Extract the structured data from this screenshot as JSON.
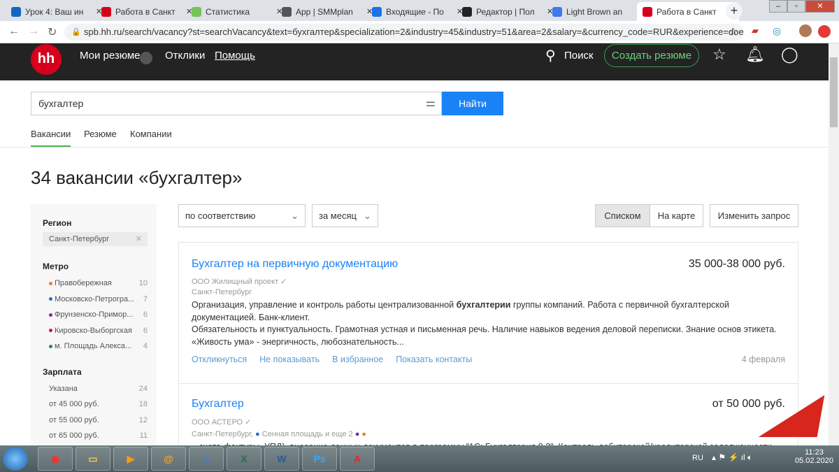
{
  "browser": {
    "tabs": [
      {
        "title": "Урок 4: Ваш ин",
        "color": "#1565c0"
      },
      {
        "title": "Работа в Санкт",
        "color": "#d6001c"
      },
      {
        "title": "Статистика",
        "color": "#78c257"
      },
      {
        "title": "App | SMMplan",
        "color": "#555"
      },
      {
        "title": "Входящие - По",
        "color": "#1a73e8"
      },
      {
        "title": "Редактор | Пол",
        "color": "#222"
      },
      {
        "title": "Light Brown an",
        "color": "#3b7bea"
      },
      {
        "title": "Работа в Санкт",
        "color": "#d6001c",
        "active": true
      }
    ],
    "url": "spb.hh.ru/search/vacancy?st=searchVacancy&text=бухгалтер&specialization=2&industry=45&industry=51&area=2&salary=&currency_code=RUR&experience=doe..."
  },
  "header": {
    "logo": "hh",
    "my_resumes": "Мои резюме",
    "responses": "Отклики",
    "help": "Помощь",
    "search": "Поиск",
    "create_resume": "Создать резюме"
  },
  "search": {
    "value": "бухгалтер",
    "button": "Найти",
    "tabs": [
      "Вакансии",
      "Резюме",
      "Компании"
    ]
  },
  "title": "34 вакансии «бухгалтер»",
  "sidebar": {
    "region_label": "Регион",
    "region": "Санкт-Петербург",
    "metro_label": "Метро",
    "metro": [
      {
        "name": "Правобережная",
        "count": "10",
        "color": "#f07a2b"
      },
      {
        "name": "Московско-Петрогра...",
        "count": "7",
        "color": "#1a6fd6"
      },
      {
        "name": "Фрунзенско-Примор...",
        "count": "6",
        "color": "#7a2a9a"
      },
      {
        "name": "Кировско-Выборгская",
        "count": "6",
        "color": "#e0103a"
      },
      {
        "name": "м. Площадь Алекса...",
        "count": "4",
        "color": "#17913a"
      }
    ],
    "salary_label": "Зарплата",
    "salary": [
      {
        "name": "Указана",
        "count": "24"
      },
      {
        "name": "от 45 000 руб.",
        "count": "18"
      },
      {
        "name": "от 55 000 руб.",
        "count": "12"
      },
      {
        "name": "от 65 000 руб.",
        "count": "11"
      }
    ]
  },
  "controls": {
    "sort": "по соответствию",
    "period": "за месяц",
    "list": "Списком",
    "map": "На карте",
    "change": "Изменить запрос"
  },
  "vacancies": [
    {
      "title": "Бухгалтер на первичную документацию",
      "salary": "35 000-38 000 руб.",
      "company": "ООО Жилищный проект",
      "location": "Санкт-Петербург",
      "desc1a": "Организация, управление и контроль работы централизованной ",
      "desc1b": "бухгалтерии",
      "desc1c": " группы компаний. Работа с первичной бухгалтерской документацией. Банк-клиент.",
      "desc2": "Обязательность и пунктуальность. Грамотная устная и письменная речь. Наличие навыков ведения деловой переписки. Знание основ этикета. «Живость ума» - энергичность, любознательность...",
      "actions": [
        "Откликнуться",
        "Не показывать",
        "В избранное",
        "Показать контакты"
      ],
      "date": "4 февраля"
    },
    {
      "title": "Бухгалтер",
      "salary": "от 50 000 руб.",
      "company": "ООО АСТЕРО",
      "location": "Санкт-Петербург,",
      "metro": "Сенная площадь и еще 2",
      "desc1": "...счета-фактуры, УПД), внесение данных документов в программу \"1С: Бухгалтерия 8.3\". Контроль дебиторской/кредиторской задолженности"
    }
  ],
  "taskbar": {
    "lang": "RU",
    "time": "11:23",
    "date": "05.02.2020"
  }
}
